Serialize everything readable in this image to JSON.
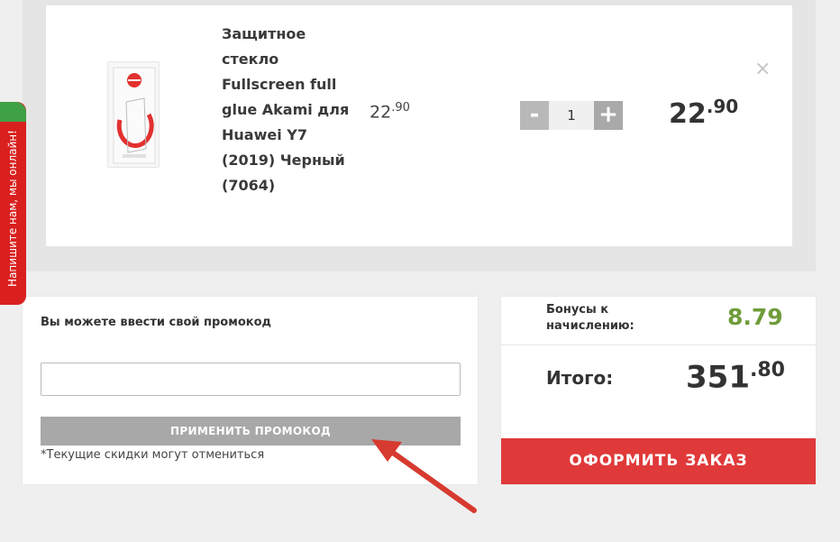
{
  "cart": {
    "item": {
      "image_icon": "product-glass-icon",
      "name": "Защитное стекло Fullscreen full glue Akami для Huawei Y7 (2019) Черный (7064)",
      "price_int": "22",
      "price_dec": ".90",
      "quantity": "1",
      "qty_minus": "-",
      "qty_plus": "+",
      "total_int": "22",
      "total_dec": ".90",
      "remove_label": "×"
    }
  },
  "promo": {
    "title": "Вы можете ввести свой промокод",
    "input_value": "",
    "input_placeholder": "",
    "button_label": "ПРИМЕНИТЬ ПРОМОКОД",
    "note": "*Текущие скидки могут отмениться"
  },
  "summary": {
    "bonus_label": "Бонусы к начислению:",
    "bonus_value": "8.79",
    "total_label": "Итого:",
    "total_int": "351",
    "total_dec": ".80",
    "checkout_label": "ОФОРМИТЬ ЗАКАЗ"
  },
  "chat_widget": {
    "label": "Напишите нам, мы онлайн!"
  },
  "colors": {
    "accent_red": "#e0393a",
    "bonus_green": "#6f9c3a",
    "button_gray": "#a8a8a8"
  }
}
